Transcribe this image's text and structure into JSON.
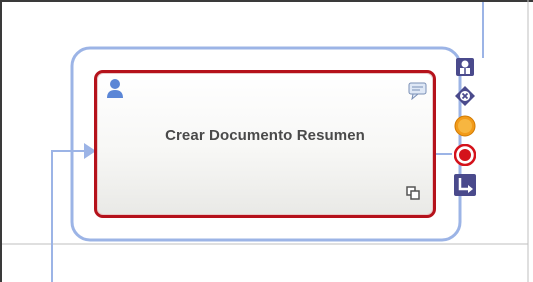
{
  "task": {
    "label": "Crear Documento Resumen",
    "type_icon": "user-icon",
    "comment_icon": "speech-bubble-icon",
    "multi_instance_icon": "stacked-windows-icon"
  },
  "context_toolbar": [
    {
      "icon": "user-role-icon"
    },
    {
      "icon": "exclusive-gateway-icon"
    },
    {
      "icon": "intermediate-event-icon"
    },
    {
      "icon": "end-event-icon"
    },
    {
      "icon": "sequence-flow-icon"
    }
  ],
  "colors": {
    "task_border": "#b5121b",
    "selection_frame": "#9cb4e6",
    "connector": "#9cb4e6",
    "toolbar_icon_bg": "#4a4a8c",
    "intermediate_event": "#f29b1a",
    "end_event": "#d4121b"
  }
}
